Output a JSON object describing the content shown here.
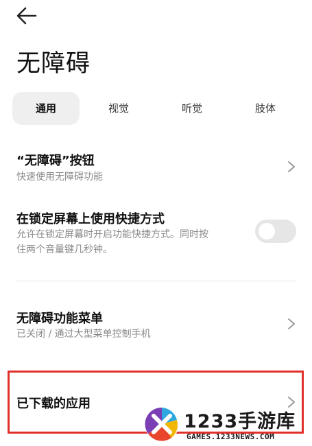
{
  "header": {
    "back_icon": "arrow-left-icon",
    "title": "无障碍"
  },
  "tabs": [
    {
      "label": "通用",
      "active": true
    },
    {
      "label": "视觉",
      "active": false
    },
    {
      "label": "听觉",
      "active": false
    },
    {
      "label": "肢体",
      "active": false
    }
  ],
  "settings": {
    "accessibility_button": {
      "title": "“无障碍”按钮",
      "subtitle": "快速使用无障碍功能"
    },
    "lock_screen_shortcut": {
      "title": "在锁定屏幕上使用快捷方式",
      "subtitle_line1": "允许在锁定屏幕时开启功能快捷方式。同时按",
      "subtitle_line2": "住两个音量键几秒钟。",
      "enabled": false
    },
    "accessibility_menu": {
      "title": "无障碍功能菜单",
      "subtitle": "已关闭 / 通过大型菜单控制手机"
    },
    "downloaded_apps": {
      "title": "已下载的应用"
    }
  },
  "colors": {
    "highlight_border": "#e0302a",
    "tab_active_bg": "#efefef",
    "toggle_off": "#e6e6e6"
  },
  "watermark": {
    "brand": "1233手游库",
    "url": "GAMES.1233NEWS.COM"
  }
}
